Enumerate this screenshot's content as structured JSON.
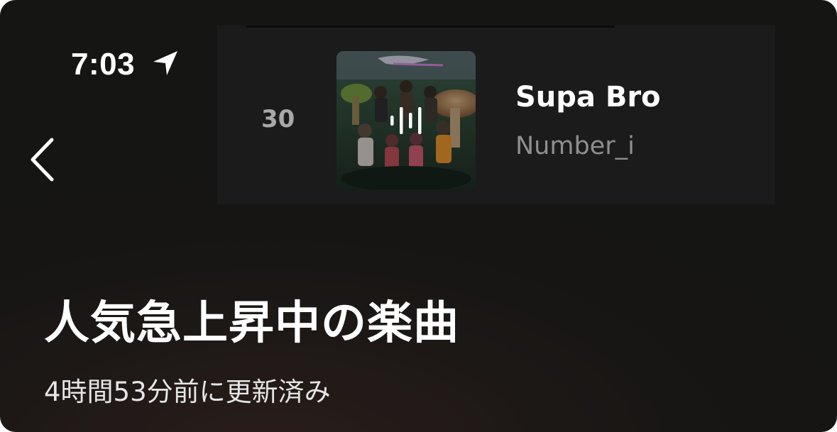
{
  "status_bar": {
    "time": "7:03",
    "location_icon": "location-arrow-icon"
  },
  "navigation": {
    "back_icon": "chevron-left-icon"
  },
  "now_playing": {
    "rank": "30",
    "title": "Supa Bro",
    "artist": "Number_i",
    "playing_icon": "audio-bars-icon"
  },
  "header": {
    "title": "人気急上昇中の楽曲",
    "subtitle": "4時間53分前に更新済み"
  },
  "colors": {
    "background": "#161514",
    "card": "#1b1b1b",
    "rank_text": "#a8a8a8",
    "artist_text": "#8f8f8f"
  }
}
